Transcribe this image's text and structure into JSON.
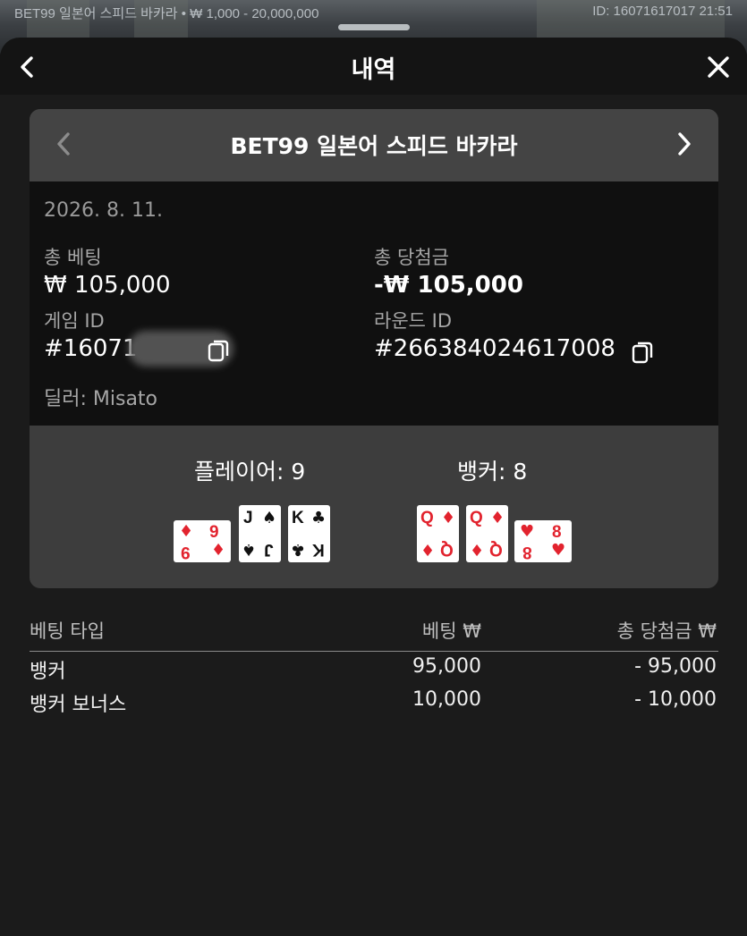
{
  "status_bar": {
    "left_text": "BET99 일본어 스피드 바카라 • ₩ 1,000 - 20,000,000",
    "right_text": "ID: 16071617017 21:51"
  },
  "header": {
    "title": "내역",
    "back_icon": "chevron-left-icon",
    "close_icon": "close-icon"
  },
  "game": {
    "title": "BET99 일본어 스피드 바카라",
    "prev_icon": "chevron-left-icon",
    "next_icon": "chevron-right-icon"
  },
  "details": {
    "date": "2026. 8. 11.",
    "total_bet_label": "총 베팅",
    "total_bet_value": "₩ 105,000",
    "total_win_label": "총 당첨금",
    "total_win_value": "-₩ 105,000",
    "game_id_label": "게임 ID",
    "game_id_value": "#16071",
    "round_id_label": "라운드 ID",
    "round_id_value": "#266384024617008",
    "dealer": "딜러: Misato"
  },
  "result": {
    "player_label": "플레이어: 9",
    "banker_label": "뱅커: 8",
    "player_cards": [
      {
        "rank": "9",
        "suit": "♦",
        "color": "red",
        "rotated": true
      },
      {
        "rank": "J",
        "suit": "♠",
        "color": "black",
        "rotated": false
      },
      {
        "rank": "K",
        "suit": "♣",
        "color": "black",
        "rotated": false
      }
    ],
    "banker_cards": [
      {
        "rank": "Q",
        "suit": "♦",
        "color": "red",
        "rotated": false
      },
      {
        "rank": "Q",
        "suit": "♦",
        "color": "red",
        "rotated": false
      },
      {
        "rank": "8",
        "suit": "♥",
        "color": "red",
        "rotated": true
      }
    ]
  },
  "bets_table": {
    "headers": [
      "베팅 타입",
      "베팅 ₩",
      "총 당첨금 ₩"
    ],
    "rows": [
      [
        "뱅커",
        "95,000",
        "- 95,000"
      ],
      [
        "뱅커 보너스",
        "10,000",
        "- 10,000"
      ]
    ]
  },
  "colors": {
    "background": "#1b1b1b",
    "card_bg": "#3d3d3d",
    "details_bg": "#101010",
    "red_suit": "#e2232e"
  }
}
